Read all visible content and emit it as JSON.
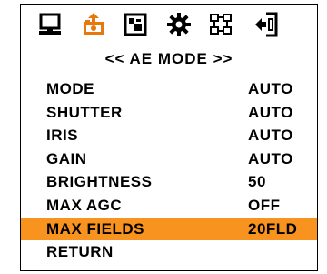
{
  "toolbar": {
    "icons": [
      "monitor-icon",
      "camera-settings-icon",
      "picture-icon",
      "gear-icon",
      "network-icon",
      "exit-icon"
    ]
  },
  "title": "<< AE MODE >>",
  "menu": {
    "items": [
      {
        "label": "MODE",
        "value": "AUTO"
      },
      {
        "label": "SHUTTER",
        "value": "AUTO"
      },
      {
        "label": "IRIS",
        "value": "AUTO"
      },
      {
        "label": "GAIN",
        "value": "AUTO"
      },
      {
        "label": "BRIGHTNESS",
        "value": "50"
      },
      {
        "label": "MAX AGC",
        "value": "OFF"
      },
      {
        "label": "MAX FIELDS",
        "value": "20FLD"
      },
      {
        "label": "RETURN",
        "value": ""
      }
    ],
    "selected_index": 6
  },
  "colors": {
    "highlight": "#f7931e",
    "text": "#000000",
    "icon_orange": "#e8780c"
  }
}
